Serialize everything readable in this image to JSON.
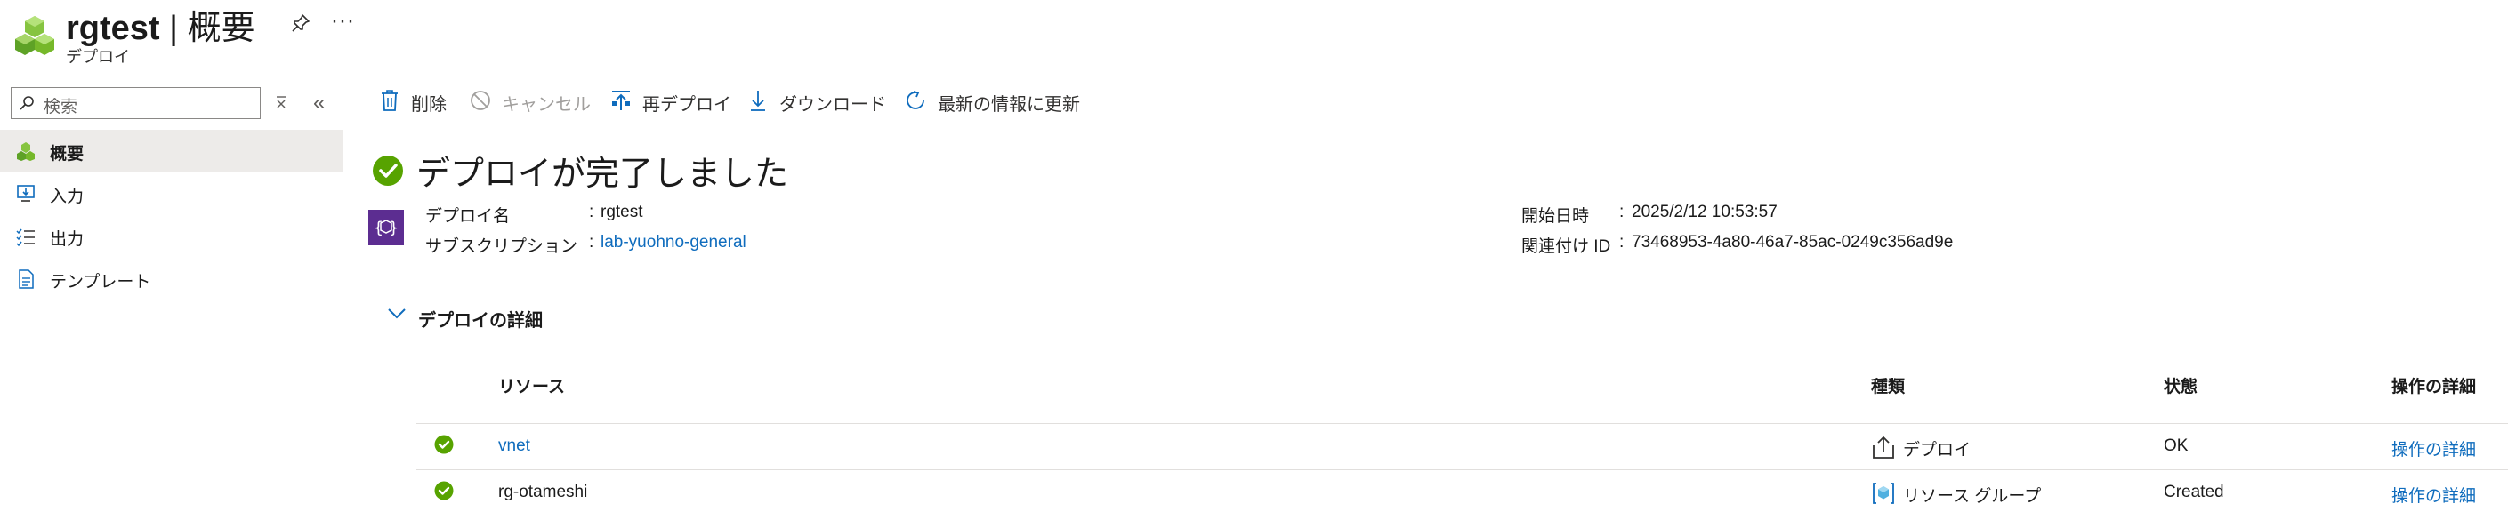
{
  "header": {
    "resource_name": "rgtest",
    "separator": " | ",
    "page_name": "概要",
    "subtitle": "デプロイ",
    "more_label": "···"
  },
  "sidebar": {
    "search_placeholder": "検索",
    "items": [
      {
        "label": "概要",
        "icon": "overview-icon",
        "active": true
      },
      {
        "label": "入力",
        "icon": "inputs-icon",
        "active": false
      },
      {
        "label": "出力",
        "icon": "outputs-icon",
        "active": false
      },
      {
        "label": "テンプレート",
        "icon": "template-icon",
        "active": false
      }
    ]
  },
  "toolbar": {
    "delete": "削除",
    "cancel": "キャンセル",
    "redeploy": "再デプロイ",
    "download": "ダウンロード",
    "refresh": "最新の情報に更新"
  },
  "status": {
    "title": "デプロイが完了しました"
  },
  "essentials": {
    "deploy_name_label": "デプロイ名",
    "deploy_name_value": "rgtest",
    "subscription_label": "サブスクリプション",
    "subscription_value": "lab-yuohno-general",
    "start_time_label": "開始日時",
    "start_time_value": "2025/2/12 10:53:57",
    "correlation_label": "関連付け ID",
    "correlation_value": "73468953-4a80-46a7-85ac-0249c356ad9e",
    "colon": ":"
  },
  "details": {
    "title": "デプロイの詳細",
    "columns": {
      "resource": "リソース",
      "type": "種類",
      "status": "状態",
      "operation": "操作の詳細"
    },
    "rows": [
      {
        "resource": "vnet",
        "type": "デプロイ",
        "status": "OK",
        "operation": "操作の詳細"
      },
      {
        "resource": "rg-otameshi",
        "type": "リソース グループ",
        "status": "Created",
        "operation": "操作の詳細"
      }
    ]
  },
  "colors": {
    "accent": "#0f6cbd",
    "success": "#57a300",
    "deploy_icon_bg": "#5c2d91"
  }
}
